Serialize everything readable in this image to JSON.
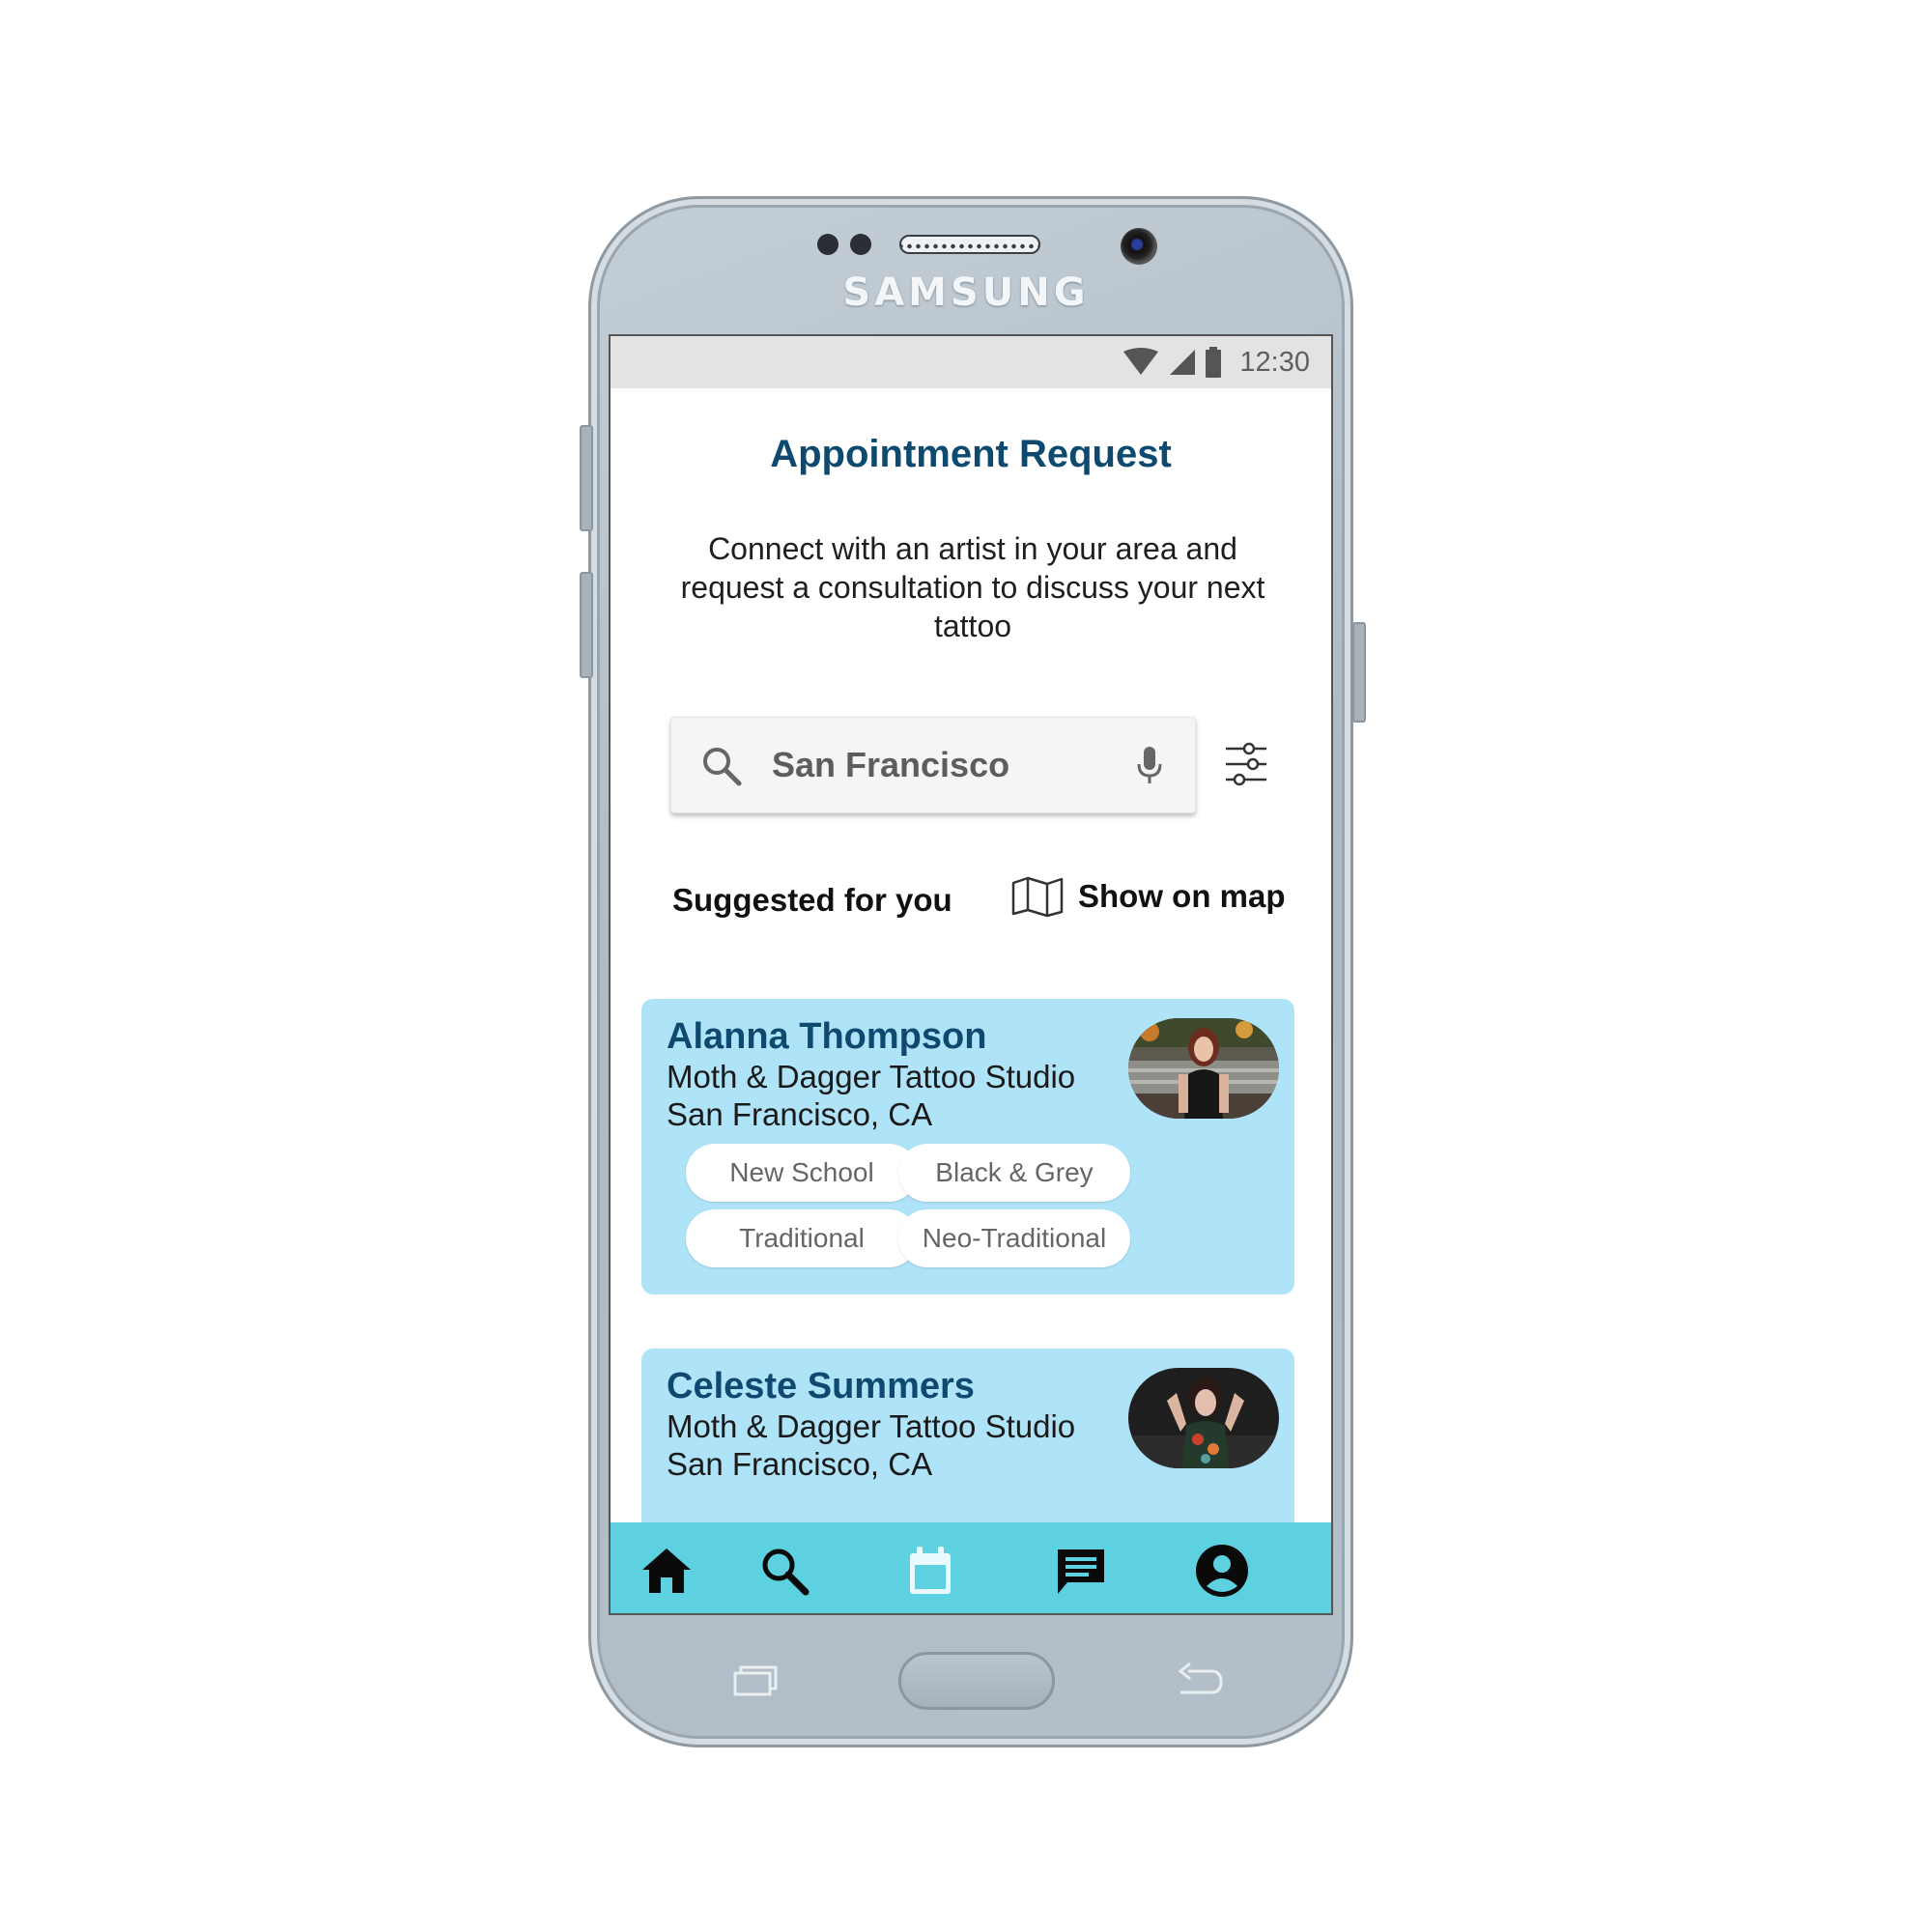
{
  "device": {
    "brand": "SAMSUNG"
  },
  "statusbar": {
    "time": "12:30",
    "icons": [
      "wifi-icon",
      "cell-signal-icon",
      "battery-icon"
    ]
  },
  "page": {
    "title": "Appointment Request",
    "subtitle": "Connect with an artist in your area and request a consultation to discuss your next tattoo"
  },
  "search": {
    "value": "San Francisco",
    "icons": [
      "search-icon",
      "mic-icon",
      "filter-sliders-icon"
    ]
  },
  "section": {
    "suggested_label": "Suggested for you",
    "show_map_label": "Show on map"
  },
  "artists": [
    {
      "name": "Alanna Thompson",
      "studio": "Moth & Dagger Tattoo Studio",
      "city": "San Francisco, CA",
      "styles": [
        "New School",
        "Black & Grey",
        "Traditional",
        "Neo-Traditional"
      ]
    },
    {
      "name": "Celeste Summers",
      "studio": "Moth & Dagger Tattoo Studio",
      "city": "San Francisco, CA",
      "styles": []
    }
  ],
  "bottom_nav": {
    "items": [
      "home-icon",
      "search-icon",
      "calendar-icon",
      "messages-icon",
      "profile-icon"
    ],
    "active": "home-icon"
  },
  "colors": {
    "title": "#0e4a70",
    "card_bg": "#afe3f8",
    "nav_bg": "#5ed1e0",
    "calendar_icon": "#e8f8fc"
  }
}
